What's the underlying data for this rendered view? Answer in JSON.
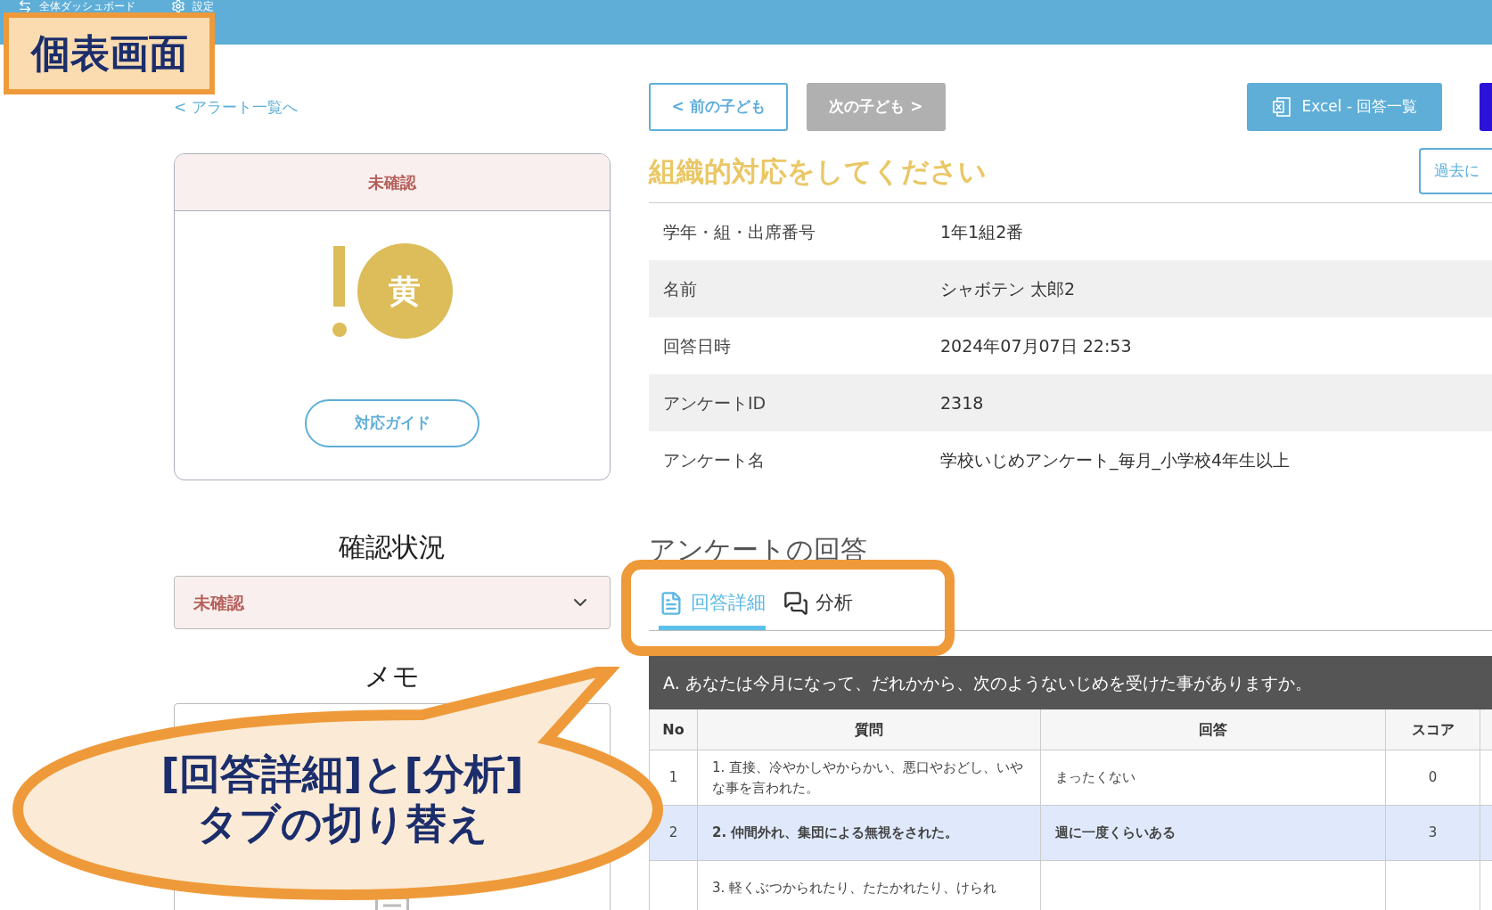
{
  "nav": {
    "items": [
      {
        "label": "全体ダッシュボード",
        "kind": "dashboard"
      },
      {
        "label": "設定",
        "kind": "settings"
      }
    ]
  },
  "badge": "個表画面",
  "back_link": "< アラート一覧へ",
  "status_card": {
    "header": "未確認",
    "level_label": "黄",
    "guide_button": "対応ガイド"
  },
  "confirm": {
    "title": "確認状況",
    "value": "未確認"
  },
  "memo": {
    "title": "メモ"
  },
  "nav_buttons": [
    {
      "label": "< 前の子ども",
      "disabled": false
    },
    {
      "label": "次の子ども >",
      "disabled": true
    }
  ],
  "export_button": "Excel - 回答一覧",
  "alert_message": "組織的対応をしてください",
  "history_button": "過去に",
  "info": [
    {
      "label": "学年・組・出席番号",
      "value": "1年1組2番"
    },
    {
      "label": "名前",
      "value": "シャボテン 太郎2"
    },
    {
      "label": "回答日時",
      "value": "2024年07月07日 22:53"
    },
    {
      "label": "アンケートID",
      "value": "2318"
    },
    {
      "label": "アンケート名",
      "value": "学校いじめアンケート_毎月_小学校4年生以上"
    }
  ],
  "answers": {
    "title": "アンケートの回答",
    "tabs": [
      {
        "label": "回答詳細",
        "kind": "document",
        "selected": true
      },
      {
        "label": "分析",
        "kind": "chat",
        "selected": false
      }
    ],
    "section": "A. あなたは今月になって、だれかから、次のようないじめを受けた事がありますか。",
    "columns": [
      "No",
      "質問",
      "回答",
      "スコア"
    ],
    "rows": [
      {
        "no": "1",
        "question": "1. 直接、冷やかしやからかい、悪口やおどし、いやな事を言われた。",
        "answer": "まったくない",
        "score": "0",
        "highlighted": false
      },
      {
        "no": "2",
        "question": "2. 仲間外れ、集団による無視をされた。",
        "answer": "週に一度くらいある",
        "score": "3",
        "highlighted": true
      },
      {
        "question": "3. 軽くぶつかられたり、たたかれたり、けられ",
        "highlighted": false
      }
    ]
  },
  "callout": {
    "lines": [
      "[回答詳細]と[分析]",
      "タブの切り替え"
    ]
  }
}
